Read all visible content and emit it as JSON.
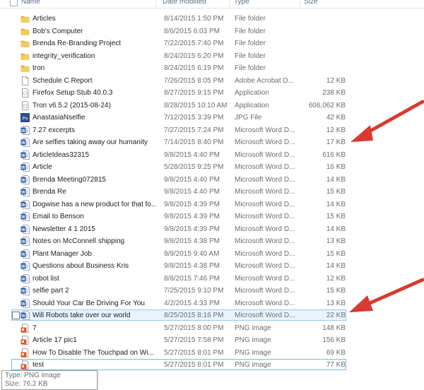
{
  "header": {
    "name": "Name",
    "date_modified": "Date modified",
    "type": "Type",
    "size": "Size"
  },
  "rows": [
    {
      "name": "Articles",
      "date": "8/14/2015 1:50 PM",
      "type": "File folder",
      "size": "",
      "icon": "folder-icon"
    },
    {
      "name": "Bob's Computer",
      "date": "8/6/2015 6:03 PM",
      "type": "File folder",
      "size": "",
      "icon": "folder-icon"
    },
    {
      "name": "Brenda Re-Branding Project",
      "date": "7/22/2015 7:40 PM",
      "type": "File folder",
      "size": "",
      "icon": "folder-icon"
    },
    {
      "name": "integrity_verification",
      "date": "8/24/2015 6:20 PM",
      "type": "File folder",
      "size": "",
      "icon": "folder-icon"
    },
    {
      "name": "tron",
      "date": "8/24/2015 6:19 PM",
      "type": "File folder",
      "size": "",
      "icon": "folder-icon"
    },
    {
      "name": "Schedule C Report",
      "date": "7/26/2015 8:05 PM",
      "type": "Adobe Acrobat D...",
      "size": "12 KB",
      "icon": "document-icon"
    },
    {
      "name": "Firefox Setup Stub 40.0.3",
      "date": "8/27/2015 9:15 PM",
      "type": "Application",
      "size": "238 KB",
      "icon": "application-icon"
    },
    {
      "name": "Tron v6.5.2 (2015-08-24)",
      "date": "8/28/2015 10:10 AM",
      "type": "Application",
      "size": "606,062 KB",
      "icon": "application-icon"
    },
    {
      "name": "AnastasiaNselfie",
      "date": "7/12/2015 3:39 PM",
      "type": "JPG File",
      "size": "42 KB",
      "icon": "photoshop-icon"
    },
    {
      "name": "7.27 excerpts",
      "date": "7/27/2015 7:24 PM",
      "type": "Microsoft Word D...",
      "size": "12 KB",
      "icon": "word-document-icon"
    },
    {
      "name": "Are selfies taking away our humanity",
      "date": "7/14/2015 8:40 PM",
      "type": "Microsoft Word D...",
      "size": "17 KB",
      "icon": "word-document-icon"
    },
    {
      "name": "ArticleIdeas32315",
      "date": "9/8/2015 4:40 PM",
      "type": "Microsoft Word D...",
      "size": "616 KB",
      "icon": "word-document-icon"
    },
    {
      "name": "Article",
      "date": "5/28/2015 9:25 PM",
      "type": "Microsoft Word D...",
      "size": "16 KB",
      "icon": "word-document-icon"
    },
    {
      "name": "Brenda Meeting072815",
      "date": "9/8/2015 4:40 PM",
      "type": "Microsoft Word D...",
      "size": "14 KB",
      "icon": "word-document-icon"
    },
    {
      "name": "Brenda Re",
      "date": "9/8/2015 4:40 PM",
      "type": "Microsoft Word D...",
      "size": "15 KB",
      "icon": "word-document-icon"
    },
    {
      "name": "Dogwise has a new product for that fo...",
      "date": "9/8/2015 4:39 PM",
      "type": "Microsoft Word D...",
      "size": "14 KB",
      "icon": "word-document-icon"
    },
    {
      "name": "Email to Benson",
      "date": "9/8/2015 4:39 PM",
      "type": "Microsoft Word D...",
      "size": "15 KB",
      "icon": "word-document-icon"
    },
    {
      "name": "Newsletter 4 1 2015",
      "date": "9/8/2015 4:39 PM",
      "type": "Microsoft Word D...",
      "size": "14 KB",
      "icon": "word-document-icon"
    },
    {
      "name": "Notes on McConnell shipping",
      "date": "9/8/2015 4:38 PM",
      "type": "Microsoft Word D...",
      "size": "13 KB",
      "icon": "word-document-icon"
    },
    {
      "name": "Plant Manager Job",
      "date": "9/9/2015 9:40 AM",
      "type": "Microsoft Word D...",
      "size": "15 KB",
      "icon": "word-document-icon"
    },
    {
      "name": "Questions about Business Kris",
      "date": "9/8/2015 4:38 PM",
      "type": "Microsoft Word D...",
      "size": "14 KB",
      "icon": "word-document-icon"
    },
    {
      "name": "robot list",
      "date": "8/8/2015 7:46 PM",
      "type": "Microsoft Word D...",
      "size": "12 KB",
      "icon": "word-document-icon"
    },
    {
      "name": "selfie part 2",
      "date": "7/25/2015 9:10 PM",
      "type": "Microsoft Word D...",
      "size": "15 KB",
      "icon": "word-document-icon"
    },
    {
      "name": "Should Your Car Be Driving For You",
      "date": "4/2/2015 4:33 PM",
      "type": "Microsoft Word D...",
      "size": "13 KB",
      "icon": "word-document-icon"
    },
    {
      "name": "Will Robots take over our world",
      "date": "8/25/2015 8:16 PM",
      "type": "Microsoft Word D...",
      "size": "22 KB",
      "icon": "word-document-icon"
    },
    {
      "name": "7",
      "date": "5/27/2015 8:00 PM",
      "type": "PNG image",
      "size": "148 KB",
      "icon": "png-image-icon"
    },
    {
      "name": "Article 17 pic1",
      "date": "5/27/2015 7:58 PM",
      "type": "PNG image",
      "size": "156 KB",
      "icon": "png-image-icon"
    },
    {
      "name": "How To Disable The Touchpad on Wi...",
      "date": "5/27/2015 8:01 PM",
      "type": "PNG image",
      "size": "69 KB",
      "icon": "png-image-icon"
    },
    {
      "name": "test",
      "date": "5/27/2015 8:01 PM",
      "type": "PNG image",
      "size": "77 KB",
      "icon": "png-image-icon"
    }
  ],
  "tooltip": {
    "type_line": "Type: PNG image",
    "size_line": "Size: 76.2 KB"
  },
  "colors": {
    "folder": "#e8b83a",
    "word_blue": "#2b579a",
    "png_orange": "#e0572a",
    "photoshop": "#2d4e8a",
    "arrow_red": "#d93a2f",
    "hover_border": "#99c9ef",
    "hover_fill": "#e9f3fc"
  }
}
